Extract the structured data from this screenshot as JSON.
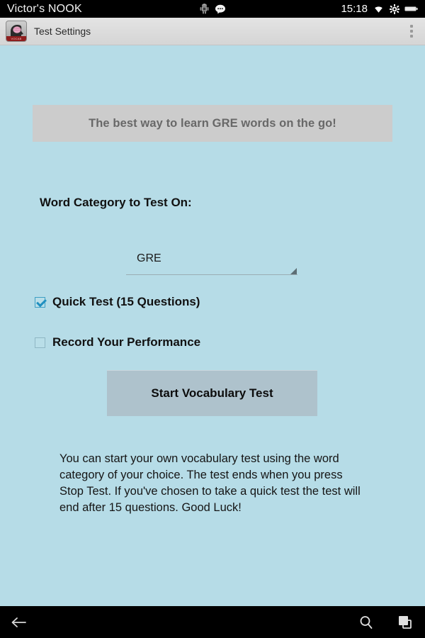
{
  "status_bar": {
    "device_name": "Victor's NOOK",
    "time": "15:18",
    "icons": {
      "android": "android-robot-icon",
      "message": "message-bubble-icon",
      "wifi": "wifi-icon",
      "settings": "gear-icon",
      "battery": "battery-icon"
    }
  },
  "action_bar": {
    "title": "Test Settings",
    "app_icon_name": "vocab-builder-app-icon",
    "app_icon_banner_text": "VOCAB BUILDER",
    "overflow_name": "overflow-menu-icon"
  },
  "main": {
    "promo_banner": "The best way to learn GRE words on the go!",
    "category_label": "Word Category to Test On:",
    "category_spinner": {
      "selected": "GRE",
      "options": [
        "GRE"
      ]
    },
    "checkboxes": [
      {
        "label": "Quick Test (15 Questions)",
        "checked": true
      },
      {
        "label": "Record Your Performance",
        "checked": false
      }
    ],
    "start_button": "Start Vocabulary Test",
    "description": "You can start your own vocabulary test using the word category of your choice. The test ends when you press Stop Test. If you've chosen to take a quick test the test will end after 15 questions. Good Luck!"
  },
  "nav_bar": {
    "back": "back-arrow-icon",
    "search": "search-icon",
    "recents": "recent-apps-icon"
  },
  "colors": {
    "background": "#b6dce7",
    "banner": "#cccccc",
    "button": "#aec2cc",
    "action_bar": "#dddddd",
    "system_bar": "#000000",
    "checkbox_accent": "#1f8fc0"
  }
}
